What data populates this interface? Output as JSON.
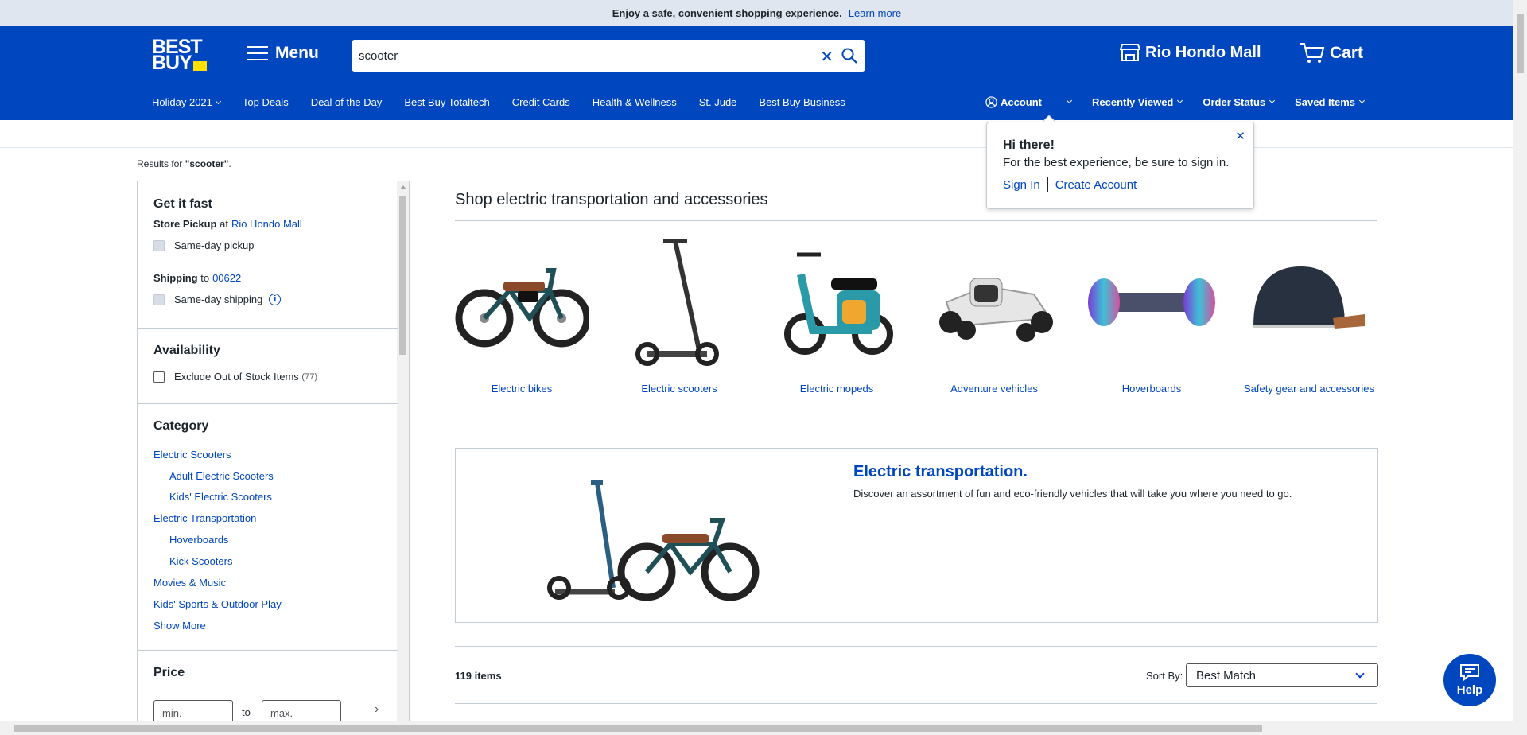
{
  "topbar": {
    "message": "Enjoy a safe, convenient shopping experience.",
    "link": "Learn more"
  },
  "header": {
    "logo_line1": "BEST",
    "logo_line2": "BUY",
    "menu_label": "Menu",
    "search_value": "scooter",
    "store_label": "Rio Hondo Mall",
    "cart_label": "Cart"
  },
  "nav": {
    "left": [
      "Holiday 2021",
      "Top Deals",
      "Deal of the Day",
      "Best Buy Totaltech",
      "Credit Cards",
      "Health & Wellness",
      "St. Jude",
      "Best Buy Business"
    ],
    "right": [
      "Account",
      "Recently Viewed",
      "Order Status",
      "Saved Items"
    ]
  },
  "results": {
    "prefix": "Results for ",
    "query": "\"scooter\"",
    "suffix": "."
  },
  "sidebar": {
    "fast": {
      "title": "Get it fast",
      "pickup_label": "Store Pickup",
      "pickup_at": "at",
      "pickup_store": "Rio Hondo Mall",
      "same_day_pickup": "Same-day pickup",
      "shipping_label": "Shipping",
      "shipping_to": "to",
      "shipping_zip": "00622",
      "same_day_shipping": "Same-day shipping"
    },
    "availability": {
      "title": "Availability",
      "exclude": "Exclude Out of Stock Items",
      "count": "(77)"
    },
    "category": {
      "title": "Category",
      "items": [
        "Electric Scooters",
        "Adult Electric Scooters",
        "Kids' Electric Scooters",
        "Electric Transportation",
        "Hoverboards",
        "Kick Scooters",
        "Movies & Music",
        "Kids' Sports & Outdoor Play"
      ],
      "show_more": "Show More"
    },
    "price": {
      "title": "Price",
      "min_placeholder": "min.",
      "to": "to",
      "max_placeholder": "max."
    }
  },
  "main": {
    "title": "Shop electric transportation and accessories",
    "tiles": [
      "Electric bikes",
      "Electric scooters",
      "Electric mopeds",
      "Adventure vehicles",
      "Hoverboards",
      "Safety gear and accessories"
    ],
    "banner": {
      "title": "Electric transportation.",
      "text": "Discover an assortment of fun and eco-friendly vehicles that will take you where you need to go."
    },
    "items_count": "119 items",
    "sort_label": "Sort By:",
    "sort_value": "Best Match"
  },
  "popover": {
    "title": "Hi there!",
    "subtitle": "For the best experience, be sure to sign in.",
    "sign_in": "Sign In",
    "create_account": "Create Account"
  },
  "help": {
    "label": "Help"
  },
  "colors": {
    "brand_blue": "#0046be",
    "brand_yellow": "#ffe000",
    "topbar_bg": "#e0e6ef"
  }
}
